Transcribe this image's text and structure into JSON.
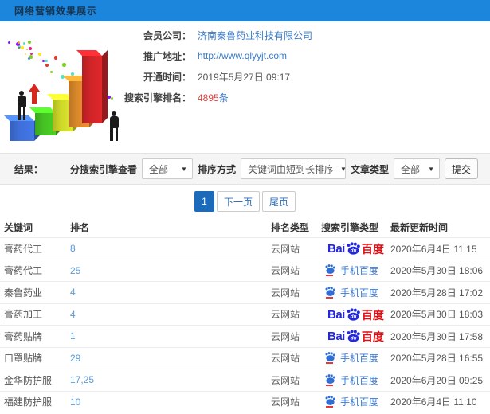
{
  "header": {
    "title": "网络营销效果展示"
  },
  "info": {
    "company_label": "会员公司：",
    "company_value": "济南秦鲁药业科技有限公司",
    "url_label": "推广地址：",
    "url_value": "http://www.qlyyjt.com",
    "opened_label": "开通时间：",
    "opened_value": "2019年5月27日 09:17",
    "rank_label": "搜索引擎排名：",
    "rank_count": "4895",
    "rank_unit": "条"
  },
  "filters": {
    "results_label": "结果：",
    "engine_label": "分搜索引擎查看",
    "engine_value": "全部",
    "sort_label": "排序方式",
    "sort_value": "关键词由短到长排序",
    "article_label": "文章类型",
    "article_value": "全部",
    "submit_label": "提交"
  },
  "pagination": {
    "current": "1",
    "next_label": "下一页",
    "last_label": "尾页"
  },
  "table": {
    "headers": [
      "关键词",
      "排名",
      "排名类型",
      "搜索引擎类型",
      "最新更新时间"
    ],
    "engine_assets": {
      "bai": "Bai",
      "du": "du",
      "baidu": "百度",
      "mobile": "手机百度"
    },
    "rows": [
      {
        "keyword": "膏药代工",
        "rank": "8",
        "rank_type": "云网站",
        "engine": "baidu-pc",
        "updated": "2020年6月4日 11:15"
      },
      {
        "keyword": "膏药代工",
        "rank": "25",
        "rank_type": "云网站",
        "engine": "baidu-mobile",
        "updated": "2020年5月30日 18:06"
      },
      {
        "keyword": "秦鲁药业",
        "rank": "4",
        "rank_type": "云网站",
        "engine": "baidu-mobile",
        "updated": "2020年5月28日 17:02"
      },
      {
        "keyword": "膏药加工",
        "rank": "4",
        "rank_type": "云网站",
        "engine": "baidu-pc",
        "updated": "2020年5月30日 18:03"
      },
      {
        "keyword": "膏药贴牌",
        "rank": "1",
        "rank_type": "云网站",
        "engine": "baidu-pc",
        "updated": "2020年5月30日 17:58"
      },
      {
        "keyword": "口罩贴牌",
        "rank": "29",
        "rank_type": "云网站",
        "engine": "baidu-mobile",
        "updated": "2020年5月28日 16:55"
      },
      {
        "keyword": "金华防护服",
        "rank": "17,25",
        "rank_type": "云网站",
        "engine": "baidu-mobile",
        "updated": "2020年6月20日 09:25"
      },
      {
        "keyword": "福建防护服",
        "rank": "10",
        "rank_type": "云网站",
        "engine": "baidu-mobile",
        "updated": "2020年6月4日 11:10"
      }
    ]
  },
  "colors": {
    "header_bg": "#1b86dc",
    "link_blue": "#3a7bc8",
    "highlight_red": "#e4393c",
    "pager_active": "#1c6bba",
    "baidu_blue": "#2428dc",
    "baidu_red": "#e30b12"
  },
  "clipart": {
    "bar_colors": [
      "#3e6fd9",
      "#45c122",
      "#cdd829",
      "#d9882a",
      "#cf2428"
    ],
    "confetti_colors": [
      "#e23a2e",
      "#f6a623",
      "#f8e71c",
      "#7ed321",
      "#4a90d2",
      "#9013fe",
      "#e91e8c",
      "#50e3c2"
    ]
  }
}
